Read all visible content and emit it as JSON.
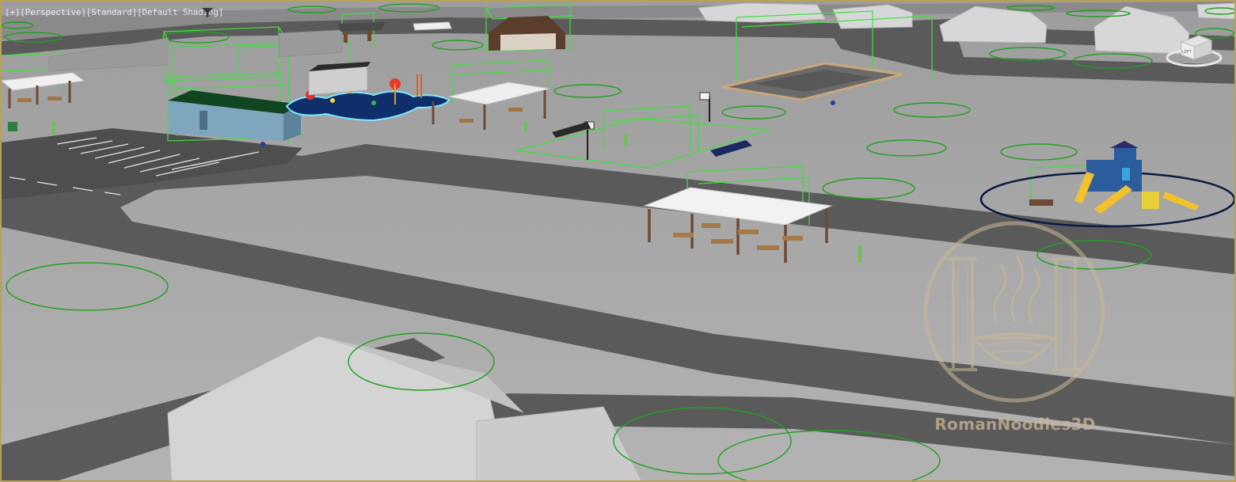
{
  "viewport": {
    "label": {
      "plus": "[+]",
      "view": "[Perspective]",
      "mode": "[Standard]",
      "shading": "[Default Shading]"
    },
    "filter_icon": "funnel-icon",
    "viewcube_icon": "viewcube-icon",
    "viewcube_face": "LEFT"
  },
  "watermark": {
    "text": "RomanNoodles3D",
    "logo": "roman-pillars-noodle-bowl-logo"
  },
  "colors": {
    "viewport_border": "#b8a25a",
    "ground": "#a9a9a9",
    "road": "#575757",
    "selection_green": "#3fe03f",
    "pool_outline": "#7fe8ff",
    "selection_circle": "#0a1a40"
  }
}
